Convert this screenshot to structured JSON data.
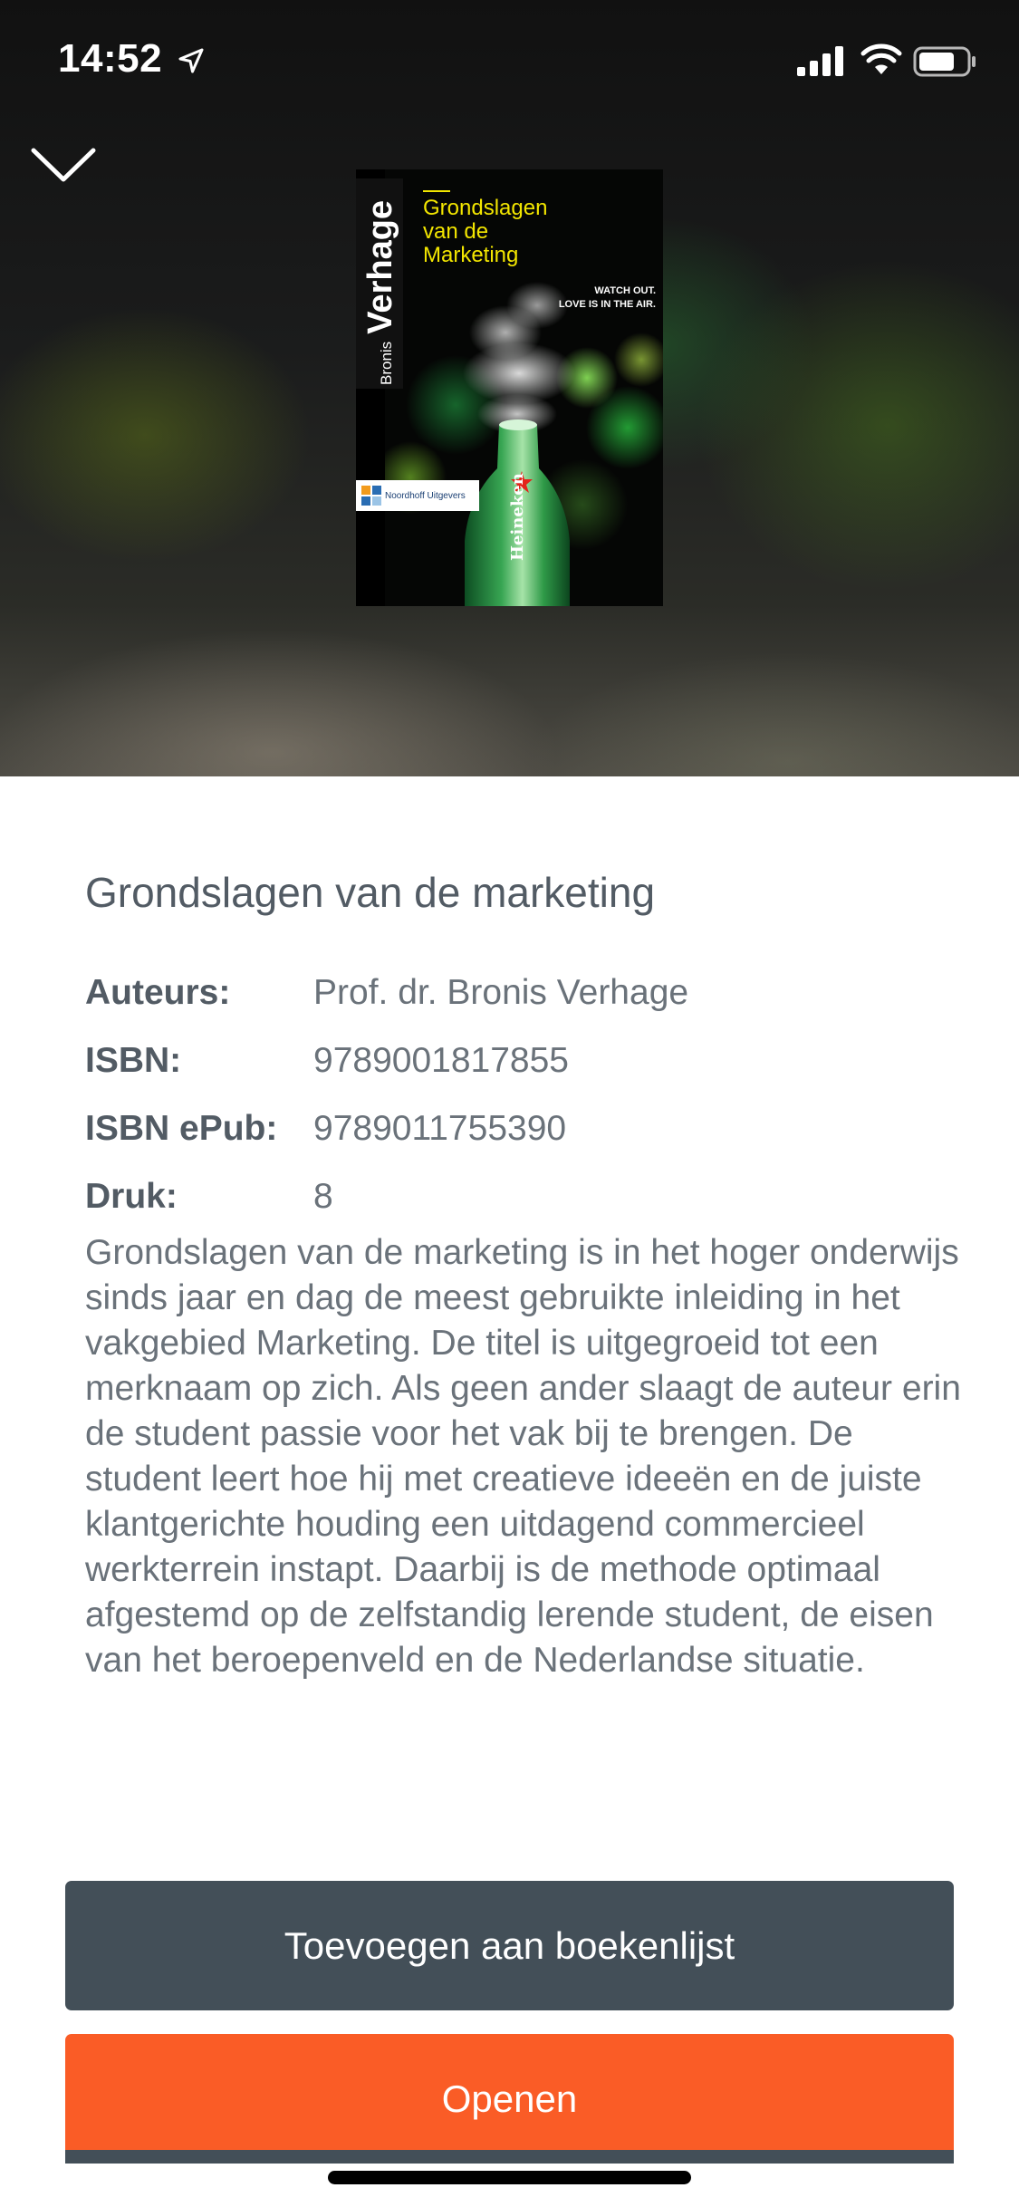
{
  "status_bar": {
    "time": "14:52",
    "icons": [
      "location-arrow-icon",
      "cellular-signal-icon",
      "wifi-icon",
      "battery-icon"
    ]
  },
  "header": {
    "close_icon": "chevron-down-icon"
  },
  "cover": {
    "author_first": "Bronis",
    "author_last": "Verhage",
    "title_line_1": "Grondslagen",
    "title_line_2": "van de",
    "title_line_3": "Marketing",
    "tagline_line_1": "WATCH OUT.",
    "tagline_line_2": "LOVE IS IN THE AIR.",
    "bottle_label": "Heineken",
    "publisher": "Noordhoff Uitgevers"
  },
  "book": {
    "title": "Grondslagen van de marketing",
    "meta": [
      {
        "label": "Auteurs:",
        "value": "Prof. dr. Bronis Verhage"
      },
      {
        "label": "ISBN:",
        "value": "9789001817855"
      },
      {
        "label": "ISBN ePub:",
        "value": "9789011755390"
      },
      {
        "label": "Druk:",
        "value": "8"
      }
    ],
    "description": "Grondslagen van de marketing is in het hoger onderwijs sinds jaar en dag de meest gebruikte inleiding in het vakgebied Marketing. De titel is uitgegroeid tot een merknaam op zich. Als geen ander slaagt de auteur erin de student passie voor het vak bij te brengen. De student leert hoe hij met creatieve ideeën en de juiste klantgerichte houding een uitdagend commercieel werkterrein instapt. Daarbij is de methode optimaal afgestemd op de zelfstandig lerende student, de eisen van het beroepenveld en de Nederlandse situatie."
  },
  "actions": {
    "add_label": "Toevoegen aan boekenlijst",
    "open_label": "Openen"
  },
  "colors": {
    "text_heading": "#525b64",
    "text_body": "#6a727a",
    "button_dark": "#434f58",
    "button_accent": "#fa5c26"
  }
}
